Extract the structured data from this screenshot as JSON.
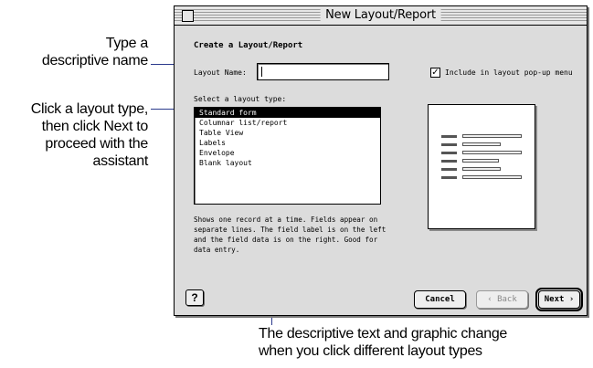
{
  "callouts": {
    "name_hint": "Type a\ndescriptive name",
    "type_hint": "Click a layout type,\nthen click Next to\nproceed with the\nassistant",
    "desc_hint": "The descriptive text and graphic change\nwhen you click different layout types"
  },
  "dialog": {
    "title": "New Layout/Report",
    "heading": "Create a Layout/Report",
    "layout_name_label": "Layout Name:",
    "layout_name_value": "",
    "include_checkbox_label": "Include in layout pop-up menu",
    "include_checked": true,
    "select_label": "Select a layout type:",
    "layout_types": [
      {
        "label": "Standard form",
        "selected": true
      },
      {
        "label": "Columnar list/report",
        "selected": false
      },
      {
        "label": "Table View",
        "selected": false
      },
      {
        "label": "Labels",
        "selected": false
      },
      {
        "label": "Envelope",
        "selected": false
      },
      {
        "label": "Blank layout",
        "selected": false
      }
    ],
    "description": "Shows one record at a time. Fields appear on separate lines. The field label is on the left and the field data is on the right. Good for data entry.",
    "help_icon": "help-icon",
    "buttons": {
      "cancel": "Cancel",
      "back": "‹ Back",
      "next": "Next ›"
    }
  }
}
